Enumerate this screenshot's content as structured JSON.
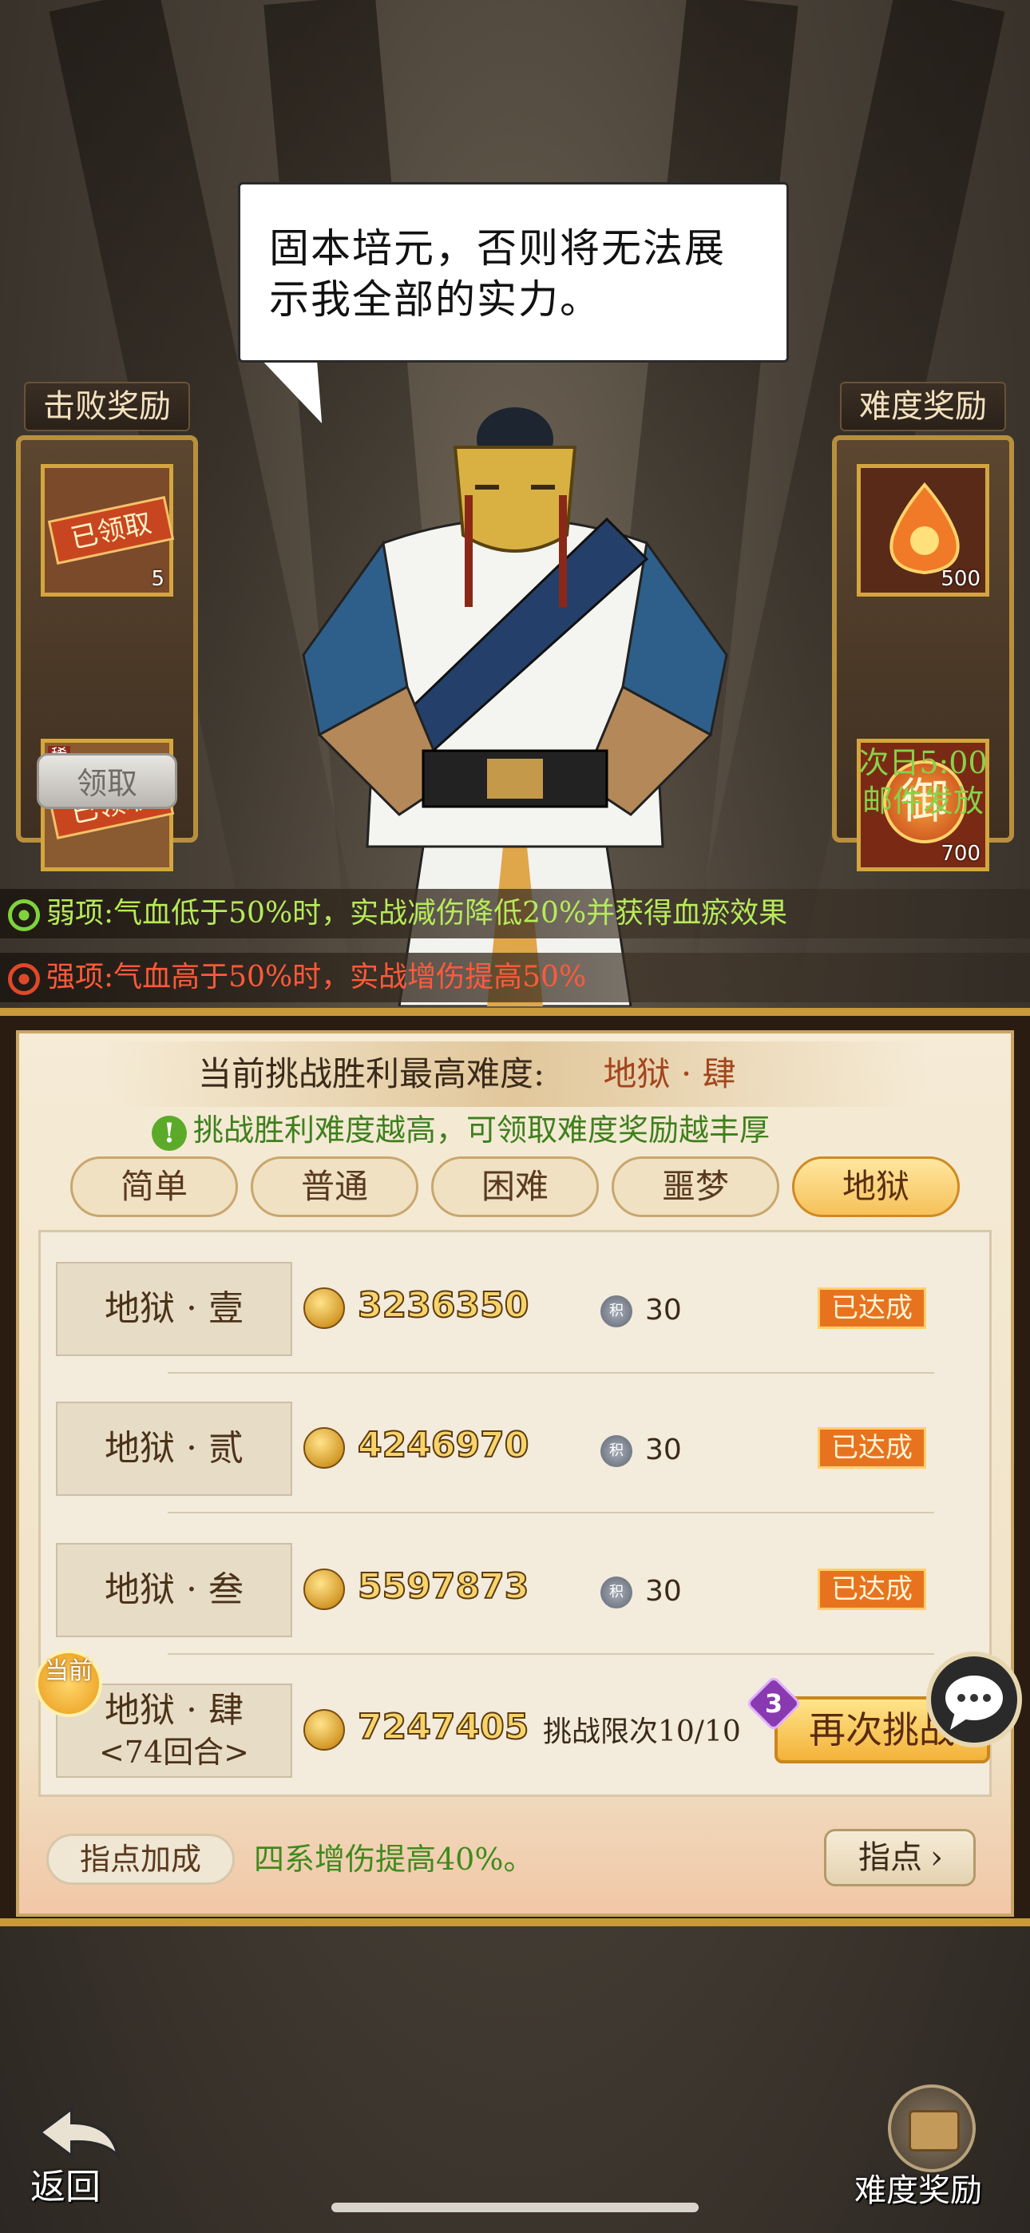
{
  "speech": {
    "line": "固本培元，否则将无法展示我全部的实力。"
  },
  "defeat_rewards": {
    "title": "击败奖励",
    "items": [
      {
        "status": "已领取",
        "count": "5"
      },
      {
        "tag": "稀有",
        "status": "已领取"
      }
    ],
    "claim_label": "领取"
  },
  "difficulty_rewards_panel": {
    "title": "难度奖励",
    "items": [
      {
        "icon": "flame-icon",
        "count": "500"
      },
      {
        "glyph": "御",
        "count": "700"
      }
    ],
    "note_line1": "次日5:00",
    "note_line2": "邮件发放"
  },
  "traits": {
    "weakness": "弱项:气血低于50%时，实战减伤降低20%并获得血瘀效果",
    "strength": "强项:气血高于50%时，实战增伤提高50%"
  },
  "challenge": {
    "highest_label": "当前挑战胜利最高难度:",
    "highest_value": "地狱 · 肆",
    "tip": "挑战胜利难度越高，可领取难度奖励越丰厚",
    "tabs": [
      "简单",
      "普通",
      "困难",
      "噩梦",
      "地狱"
    ],
    "active_tab": "地狱",
    "levels": [
      {
        "name": "地狱 · 壹",
        "score": "3236350",
        "token_label": "积",
        "tokens": "30",
        "status": "已达成"
      },
      {
        "name": "地狱 · 贰",
        "score": "4246970",
        "token_label": "积",
        "tokens": "30",
        "status": "已达成"
      },
      {
        "name": "地狱 · 叁",
        "score": "5597873",
        "token_label": "积",
        "tokens": "30",
        "status": "已达成"
      }
    ],
    "current": {
      "badge": "当前",
      "name": "地狱 · 肆",
      "rounds": "<74回合>",
      "score": "7247405",
      "limit_text": "挑战限次10/10",
      "retry_badge": "3",
      "retry_label": "再次挑战"
    }
  },
  "guidance": {
    "label": "指点加成",
    "text": "四系增伤提高40%。",
    "button": "指点"
  },
  "bottom": {
    "back": "返回",
    "difficulty_reward": "难度奖励"
  },
  "colors": {
    "gold": "#c99a3a",
    "green": "#3f7f1d",
    "red": "#e0482a",
    "orange": "#e8731e"
  }
}
